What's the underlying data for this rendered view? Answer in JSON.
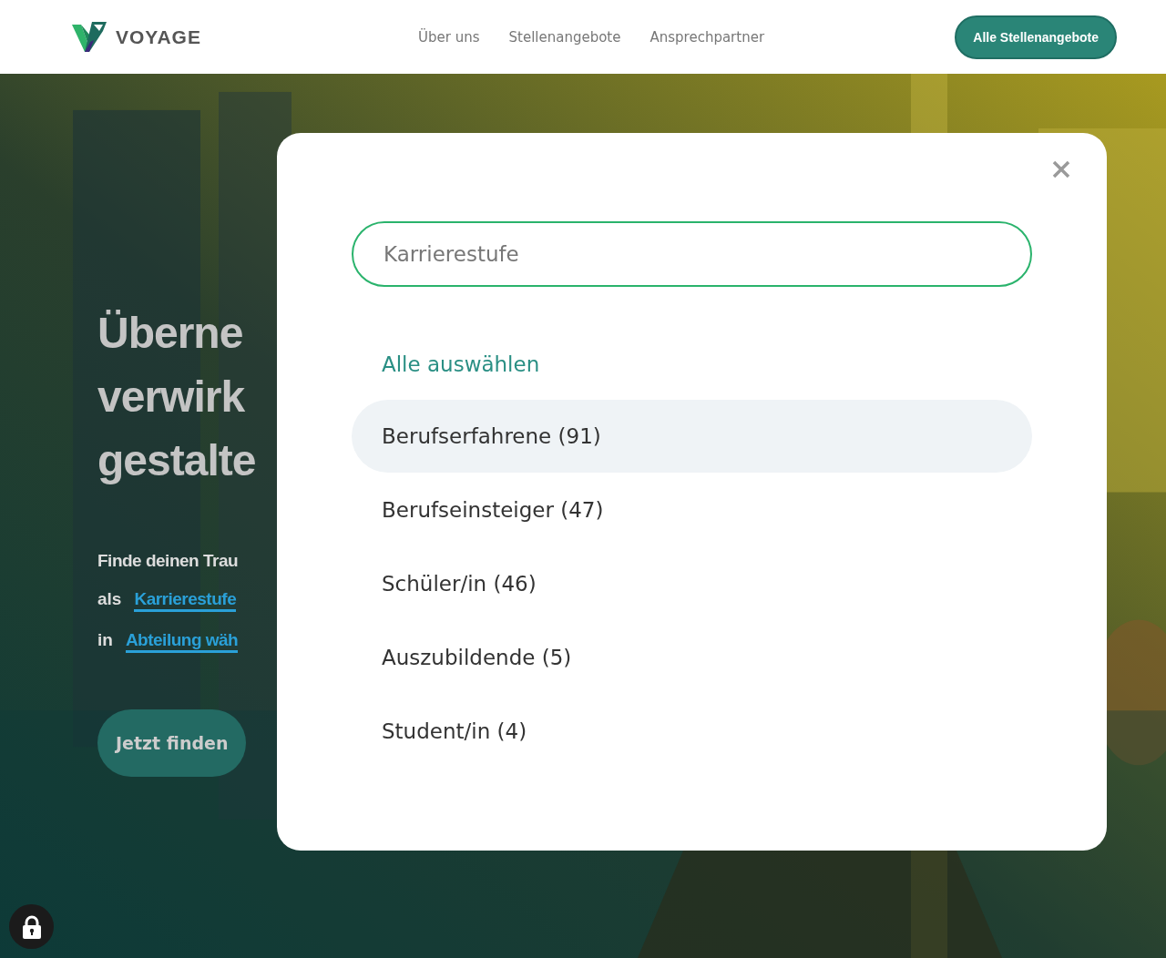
{
  "header": {
    "brand": "VOYAGE",
    "nav": [
      "Über uns",
      "Stellenangebote",
      "Ansprechpartner"
    ],
    "cta": "Alle Stellenangebote"
  },
  "hero": {
    "headline": [
      "Überne",
      "verwirk",
      "gestalte"
    ],
    "intro": "Finde deinen Trau",
    "level_prefix": "als",
    "level_link": "Karrierestufe",
    "department_prefix": "in",
    "department_link": "Abteilung wäh",
    "button": "Jetzt finden"
  },
  "modal": {
    "search": {
      "placeholder": "Karrierestufe"
    },
    "select_all": "Alle auswählen",
    "options": [
      {
        "label": "Berufserfahrene (91)",
        "selected": true
      },
      {
        "label": "Berufseinsteiger (47)",
        "selected": false
      },
      {
        "label": "Schüler/in (46)",
        "selected": false
      },
      {
        "label": "Auszubildende (5)",
        "selected": false
      },
      {
        "label": "Student/in (4)",
        "selected": false
      }
    ]
  }
}
